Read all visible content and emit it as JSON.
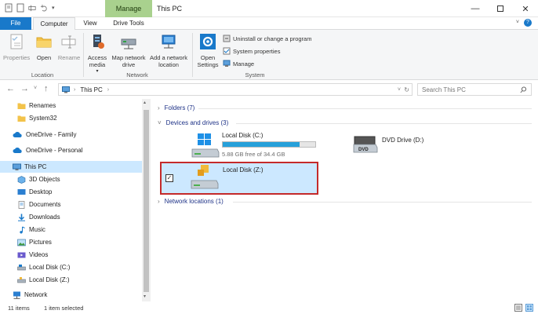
{
  "window": {
    "title": "This PC",
    "context_tab": "Manage"
  },
  "tabs": {
    "file": "File",
    "computer": "Computer",
    "view": "View",
    "drive_tools": "Drive Tools"
  },
  "ribbon": {
    "location": {
      "label": "Location",
      "properties": "Properties",
      "open": "Open",
      "rename": "Rename"
    },
    "network": {
      "label": "Network",
      "access_media": "Access media",
      "map_network_drive": "Map network drive",
      "add_network_location": "Add a network location"
    },
    "system": {
      "label": "System",
      "open_settings": "Open Settings",
      "uninstall": "Uninstall or change a program",
      "system_properties": "System properties",
      "manage": "Manage"
    }
  },
  "address": {
    "path": "This PC",
    "search_placeholder": "Search This PC"
  },
  "nav_pane": {
    "items": [
      {
        "label": "Renames",
        "icon": "folder-icon"
      },
      {
        "label": "System32",
        "icon": "folder-icon"
      },
      {
        "label": "OneDrive - Family",
        "icon": "cloud-icon"
      },
      {
        "label": "OneDrive - Personal",
        "icon": "cloud-icon"
      },
      {
        "label": "This PC",
        "icon": "computer-icon",
        "selected": true
      },
      {
        "label": "3D Objects",
        "icon": "cube-icon"
      },
      {
        "label": "Desktop",
        "icon": "desktop-icon"
      },
      {
        "label": "Documents",
        "icon": "documents-icon"
      },
      {
        "label": "Downloads",
        "icon": "download-icon"
      },
      {
        "label": "Music",
        "icon": "music-icon"
      },
      {
        "label": "Pictures",
        "icon": "pictures-icon"
      },
      {
        "label": "Videos",
        "icon": "videos-icon"
      },
      {
        "label": "Local Disk (C:)",
        "icon": "drive-icon"
      },
      {
        "label": "Local Disk (Z:)",
        "icon": "drive-icon"
      },
      {
        "label": "Network",
        "icon": "network-icon"
      }
    ]
  },
  "content": {
    "folders_header": "Folders (7)",
    "devices_header": "Devices and drives (3)",
    "network_header": "Network locations (1)",
    "drives": {
      "c": {
        "name": "Local Disk (C:)",
        "free": "5.88 GB free of 34.4 GB",
        "used_fraction": 0.83
      },
      "dvd": {
        "name": "DVD Drive (D:)",
        "disc_label": "DVD"
      },
      "z": {
        "name": "Local Disk (Z:)"
      }
    }
  },
  "status": {
    "items": "11 items",
    "selected": "1 item selected"
  },
  "colors": {
    "accent": "#1979ca",
    "manage_tab": "#a9d18e",
    "selection": "#cce8ff",
    "highlight_border": "#c42a2a",
    "usage_bar": "#26a0da"
  }
}
